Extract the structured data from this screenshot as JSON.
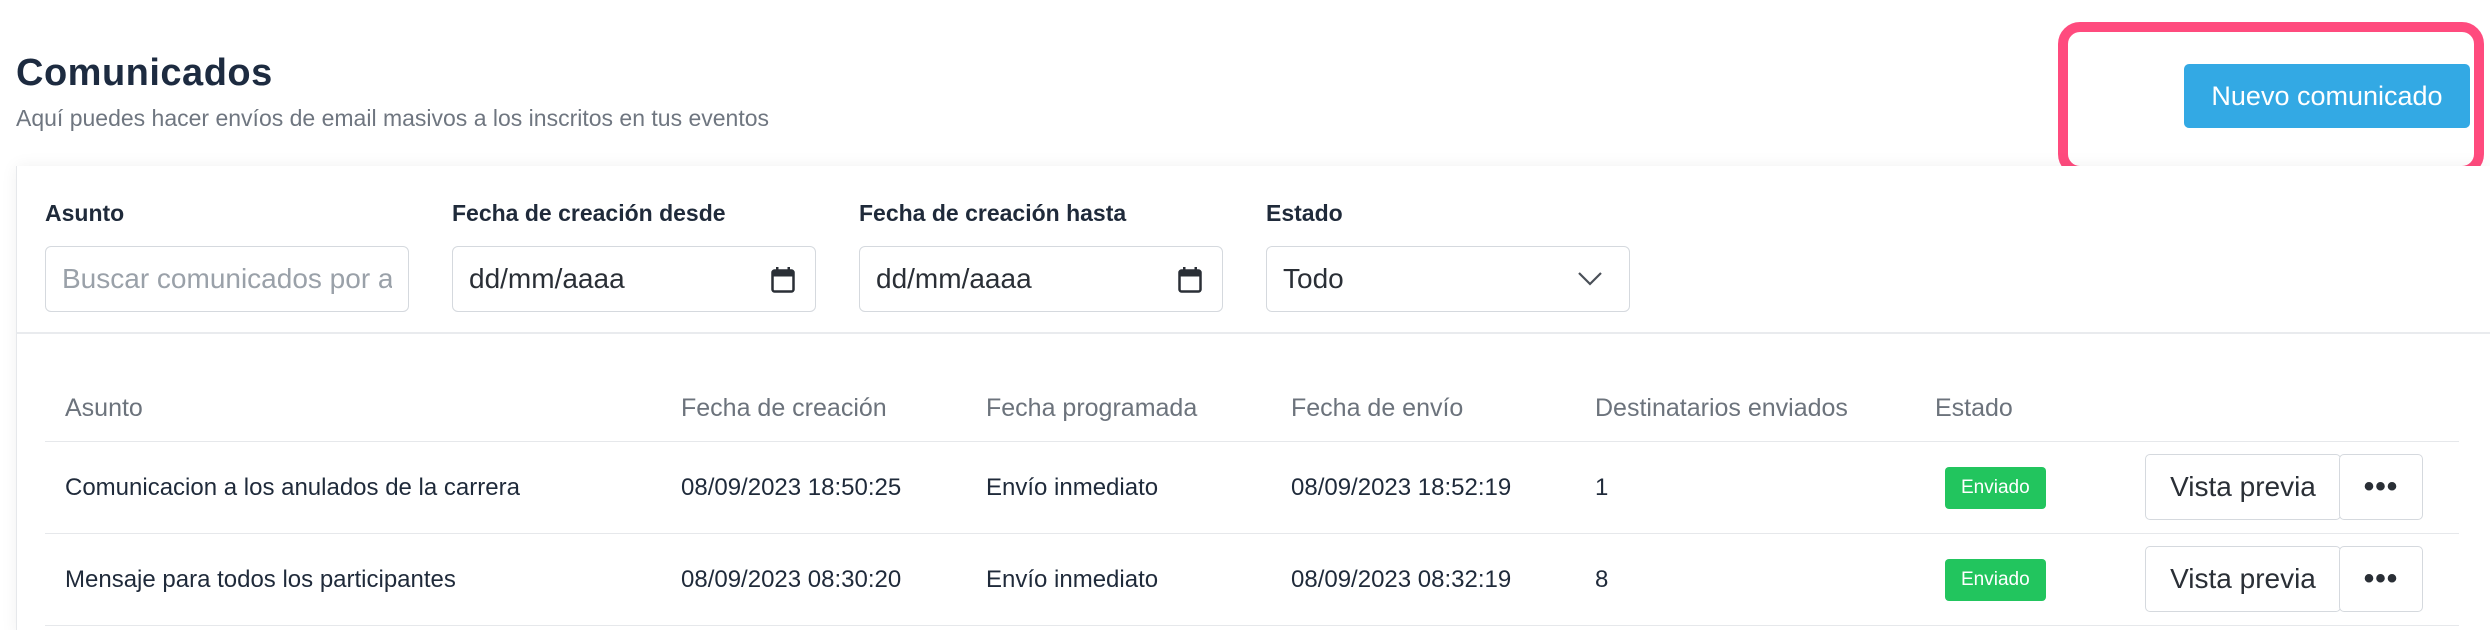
{
  "header": {
    "title": "Comunicados",
    "subtitle": "Aquí puedes hacer envíos de email masivos a los inscritos en tus eventos",
    "new_button_label": "Nuevo comunicado"
  },
  "filters": {
    "subject": {
      "label": "Asunto",
      "placeholder": "Buscar comunicados por asunto"
    },
    "date_from": {
      "label": "Fecha de creación desde",
      "value": "dd/mm/aaaa",
      "icon": "calendar-icon"
    },
    "date_to": {
      "label": "Fecha de creación hasta",
      "value": "dd/mm/aaaa",
      "icon": "calendar-icon"
    },
    "status": {
      "label": "Estado",
      "selected": "Todo",
      "icon": "chevron-down-icon"
    }
  },
  "table": {
    "columns": [
      "Asunto",
      "Fecha de creación",
      "Fecha programada",
      "Fecha de envío",
      "Destinatarios enviados",
      "Estado"
    ],
    "rows": [
      {
        "subject": "Comunicacion a los anulados de la carrera",
        "created": "08/09/2023 18:50:25",
        "scheduled": "Envío inmediato",
        "sent": "08/09/2023 18:52:19",
        "recipients": "1",
        "status": "Enviado",
        "preview_label": "Vista previa",
        "more_label": "•••"
      },
      {
        "subject": "Mensaje para todos los participantes",
        "created": "08/09/2023 08:30:20",
        "scheduled": "Envío inmediato",
        "sent": "08/09/2023 08:32:19",
        "recipients": "8",
        "status": "Enviado",
        "preview_label": "Vista previa",
        "more_label": "•••"
      }
    ]
  },
  "colors": {
    "primary": "#33a9e4",
    "highlight": "#ff4b7e",
    "status_sent": "#22c55e"
  }
}
